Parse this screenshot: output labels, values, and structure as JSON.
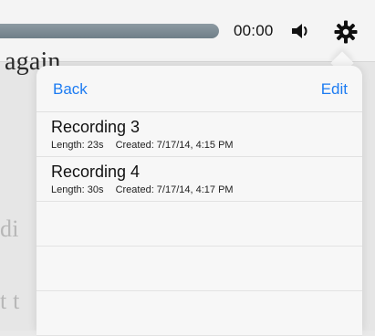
{
  "player": {
    "time": "00:00"
  },
  "background": {
    "text_top": "again.",
    "text_mid": "di",
    "text_bot": "t t"
  },
  "popover": {
    "back_label": "Back",
    "edit_label": "Edit",
    "recordings": [
      {
        "title": "Recording 3",
        "length": "Length: 23s",
        "created": "Created: 7/17/14, 4:15 PM"
      },
      {
        "title": "Recording 4",
        "length": "Length: 30s",
        "created": "Created: 7/17/14, 4:17 PM"
      }
    ]
  },
  "colors": {
    "accent": "#1d7cf2",
    "track": "#7b8a92"
  },
  "icons": {
    "volume": "speaker-icon",
    "settings": "gear-icon"
  }
}
